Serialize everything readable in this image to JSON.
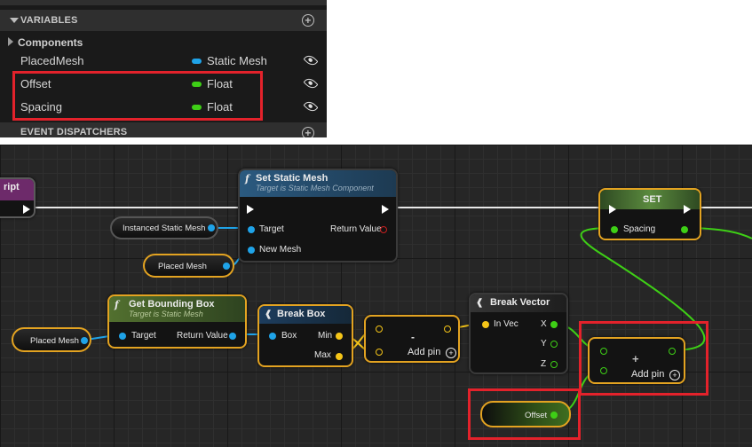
{
  "panel": {
    "variables_header": "VARIABLES",
    "components_label": "Components",
    "rows": [
      {
        "name": "PlacedMesh",
        "type": "Static Mesh",
        "type_color": "#1fa3e8"
      },
      {
        "name": "Offset",
        "type": "Float",
        "type_color": "#3ecf16"
      },
      {
        "name": "Spacing",
        "type": "Float",
        "type_color": "#3ecf16"
      }
    ],
    "dispatchers_header": "EVENT DISPATCHERS"
  },
  "graph": {
    "event_node_title": "ript",
    "set_static_mesh": {
      "title": "Set Static Mesh",
      "subtitle": "Target is Static Mesh Component",
      "target": "Target",
      "return": "Return Value",
      "new_mesh": "New Mesh"
    },
    "instanced_getter": "Instanced Static Mesh",
    "placed_mesh_getter_1": "Placed Mesh",
    "placed_mesh_getter_2": "Placed Mesh",
    "get_bounding_box": {
      "title": "Get Bounding Box",
      "subtitle": "Target is Static Mesh",
      "target": "Target",
      "return": "Return Value"
    },
    "break_box": {
      "title": "Break Box",
      "box": "Box",
      "min": "Min",
      "max": "Max"
    },
    "subtract": {
      "symbol": "-",
      "add_pin": "Add pin"
    },
    "break_vector": {
      "title": "Break Vector",
      "in_vec": "In Vec",
      "x": "X",
      "y": "Y",
      "z": "Z"
    },
    "set_node": {
      "title": "SET",
      "spacing": "Spacing"
    },
    "add_node": {
      "symbol": "+",
      "add_pin": "Add pin"
    },
    "offset_getter": "Offset"
  },
  "colors": {
    "object_pin": "#1fa3e8",
    "float_pin": "#3ecf16",
    "vector_pin": "#f5c518",
    "highlight": "#e3222b",
    "node_border": "#e3a321"
  }
}
